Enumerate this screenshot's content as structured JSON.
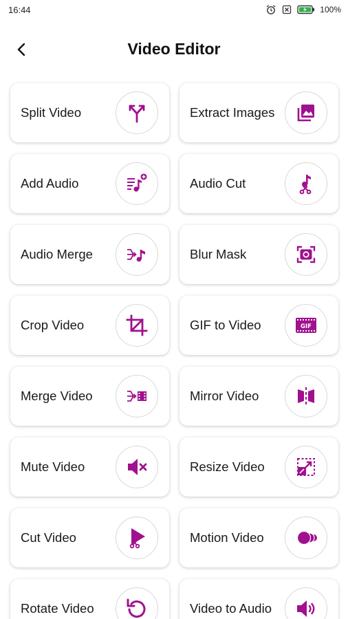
{
  "status_bar": {
    "time": "16:44",
    "battery": "100%",
    "icons": [
      "alarm-icon",
      "sim-off-icon",
      "battery-charging-icon"
    ]
  },
  "header": {
    "title": "Video Editor",
    "back_icon": "chevron-left-icon"
  },
  "accent_color": "#a0108f",
  "tools": [
    {
      "label": "Split Video",
      "icon": "split-icon"
    },
    {
      "label": "Extract Images",
      "icon": "images-icon"
    },
    {
      "label": "Add Audio",
      "icon": "add-music-icon"
    },
    {
      "label": "Audio Cut",
      "icon": "music-scissors-icon"
    },
    {
      "label": "Audio Merge",
      "icon": "merge-music-icon"
    },
    {
      "label": "Blur Mask",
      "icon": "blur-mask-icon"
    },
    {
      "label": "Crop Video",
      "icon": "crop-icon"
    },
    {
      "label": "GIF to Video",
      "icon": "gif-icon"
    },
    {
      "label": "Merge Video",
      "icon": "merge-film-icon"
    },
    {
      "label": "Mirror Video",
      "icon": "mirror-icon"
    },
    {
      "label": "Mute Video",
      "icon": "mute-icon"
    },
    {
      "label": "Resize Video",
      "icon": "resize-icon"
    },
    {
      "label": "Cut Video",
      "icon": "play-scissors-icon"
    },
    {
      "label": "Motion Video",
      "icon": "motion-icon"
    },
    {
      "label": "Rotate Video",
      "icon": "rotate-icon"
    },
    {
      "label": "Video to Audio",
      "icon": "speaker-icon"
    }
  ]
}
